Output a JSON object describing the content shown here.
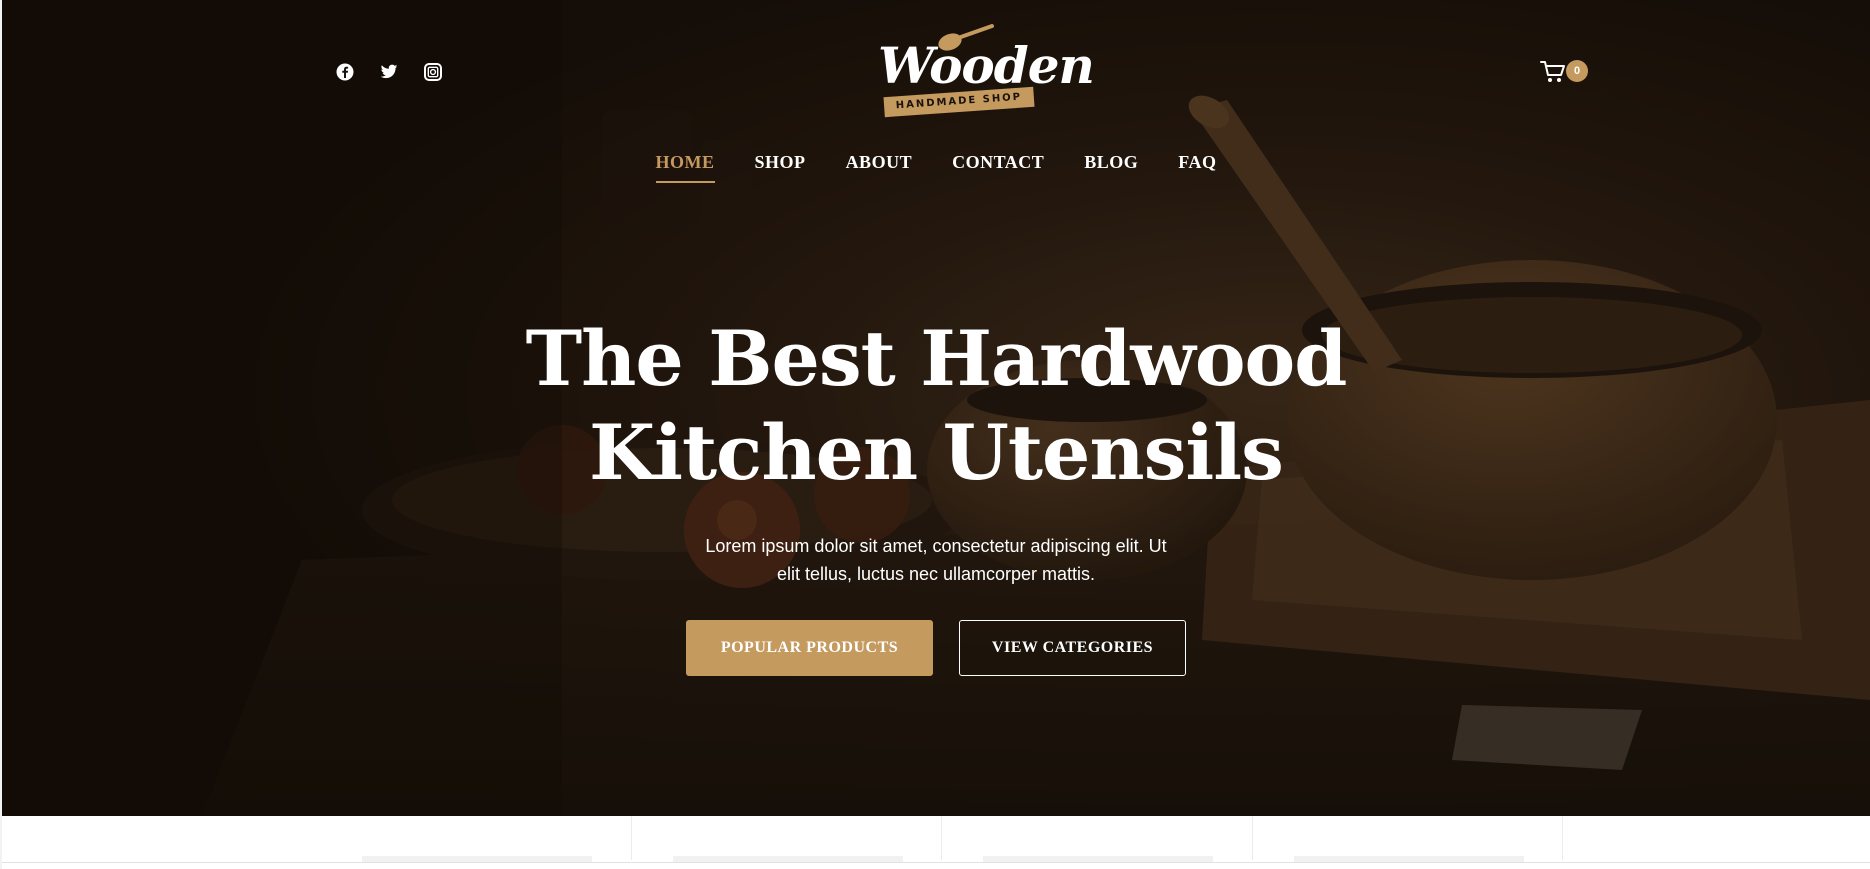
{
  "header": {
    "logo": {
      "word": "Wooden",
      "tagline": "HANDMADE SHOP"
    },
    "social": [
      {
        "name": "facebook-icon"
      },
      {
        "name": "twitter-icon"
      },
      {
        "name": "instagram-icon"
      }
    ],
    "cart": {
      "icon": "cart-icon",
      "count": "0"
    },
    "nav": [
      {
        "label": "HOME",
        "active": true
      },
      {
        "label": "SHOP",
        "active": false
      },
      {
        "label": "ABOUT",
        "active": false
      },
      {
        "label": "CONTACT",
        "active": false
      },
      {
        "label": "BLOG",
        "active": false
      },
      {
        "label": "FAQ",
        "active": false
      }
    ]
  },
  "hero": {
    "title_line1": "The Best Hardwood",
    "title_line2": "Kitchen Utensils",
    "subtitle_line1": "Lorem ipsum dolor sit amet, consectetur adipiscing elit. Ut",
    "subtitle_line2": "elit tellus, luctus nec ullamcorper mattis.",
    "primary_button": "POPULAR PRODUCTS",
    "secondary_button": "VIEW CATEGORIES"
  },
  "colors": {
    "accent": "#c49a5f",
    "hero_dark": "#1b120b",
    "text_light": "#ffffff"
  }
}
